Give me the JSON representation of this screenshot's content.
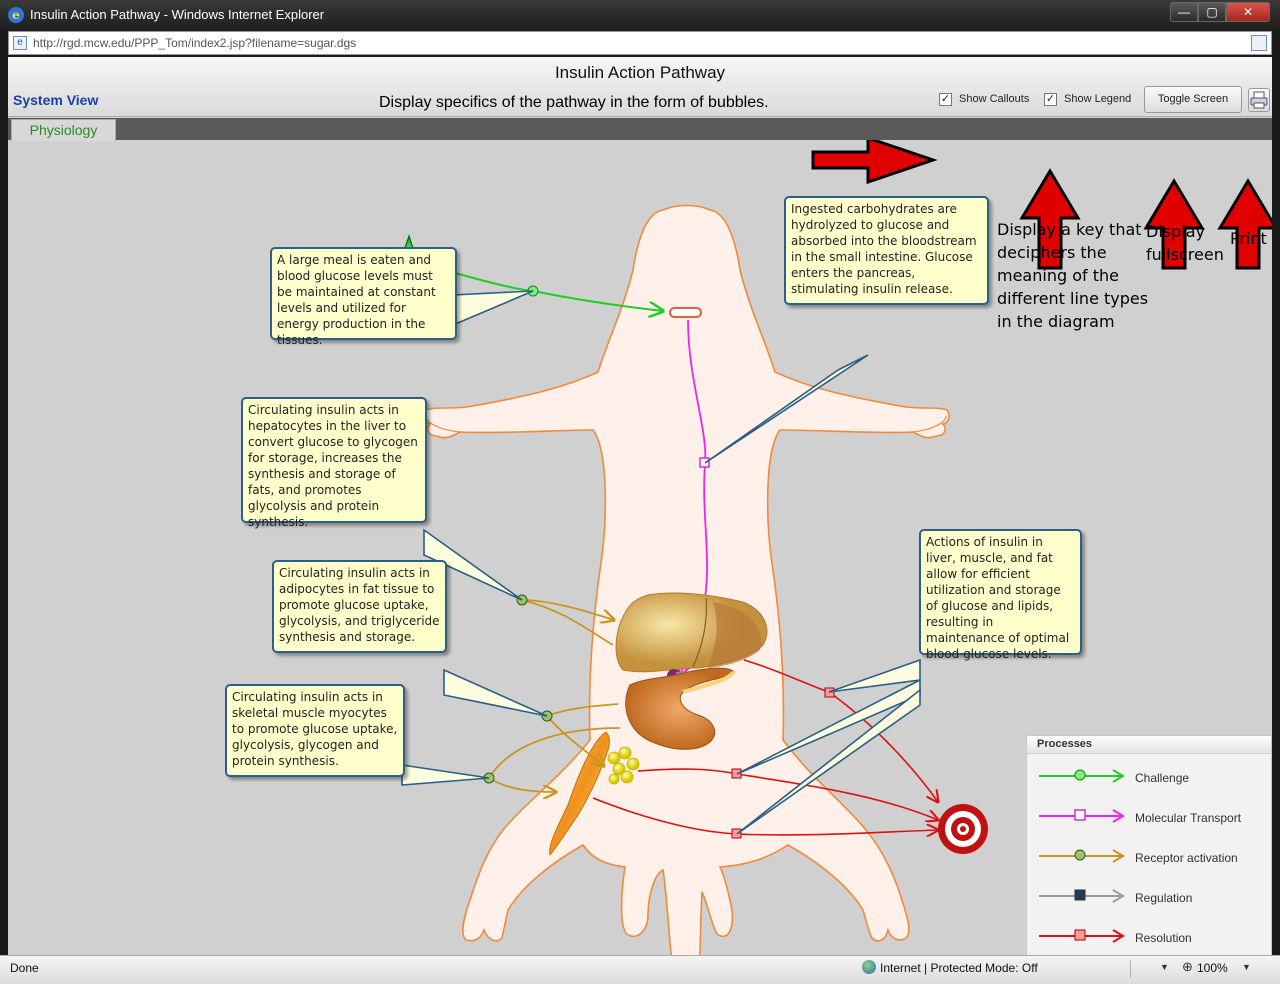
{
  "window": {
    "title": "Insulin Action Pathway - Windows Internet Explorer",
    "url": "http://rgd.mcw.edu/PPP_Tom/index2.jsp?filename=sugar.dgs",
    "min_glyph": "—",
    "max_glyph": "▢",
    "close_glyph": "✕"
  },
  "app": {
    "title": "Insulin Action Pathway",
    "system_view": "System View",
    "show_callouts_label": "Show Callouts",
    "show_legend_label": "Show Legend",
    "show_callouts_checked": true,
    "show_legend_checked": true,
    "check_glyph": "✓",
    "toggle_screen_label": "Toggle Screen",
    "tab_label": "Physiology"
  },
  "annotations": {
    "callouts_note": "Display specifics of the pathway in the form of bubbles.",
    "legend_note_lines": [
      "Display a key that",
      "deciphers the",
      "meaning of the",
      "different line types",
      "in the diagram"
    ],
    "fullscreen_note_lines": [
      "Display",
      "fullscreen"
    ],
    "print_note": "Print"
  },
  "callouts": {
    "meal": "A large meal is eaten and blood glucose levels must be maintained at constant levels and utilized for energy production in the tissues.",
    "ingested": "Ingested carbohydrates are hydrolyzed to glucose and absorbed into the bloodstream in the small intestine.  Glucose enters the pancreas, stimulating insulin release.",
    "liver": "Circulating insulin acts in hepatocytes in the liver to convert glucose to glycogen for storage, increases the synthesis and storage of fats, and promotes glycolysis and protein synthesis.",
    "fat": "Circulating insulin acts in adipocytes in fat tissue to promote glucose uptake, glycolysis, and triglyceride synthesis and storage.",
    "muscle": "Circulating insulin acts in skeletal muscle myocytes to promote glucose uptake, glycolysis, glycogen and protein synthesis.",
    "actions": "Actions of insulin in liver, muscle, and fat allow for efficient utilization and storage of glucose and lipids, resulting in maintenance of optimal blood glucose levels."
  },
  "legend": {
    "title": "Processes",
    "items": [
      {
        "label": "Challenge",
        "color": "#22cc22",
        "marker": "circle"
      },
      {
        "label": "Molecular Transport",
        "color": "#ee22ee",
        "marker": "square"
      },
      {
        "label": "Receptor activation",
        "color": "#c8961e",
        "marker": "circle"
      },
      {
        "label": "Regulation",
        "color": "#9a9a9a",
        "marker": "square"
      },
      {
        "label": "Resolution",
        "color": "#dd1111",
        "marker": "square"
      }
    ]
  },
  "status": {
    "left": "Done",
    "zone": "Internet | Protected Mode: Off",
    "zoom": "100%"
  },
  "colors": {
    "callout_fill": "#ffffcc",
    "callout_border": "#2a5f86",
    "arrow_red": "#e00000",
    "body_fill": "#fff1ea",
    "body_outline": "#f08a3a"
  }
}
